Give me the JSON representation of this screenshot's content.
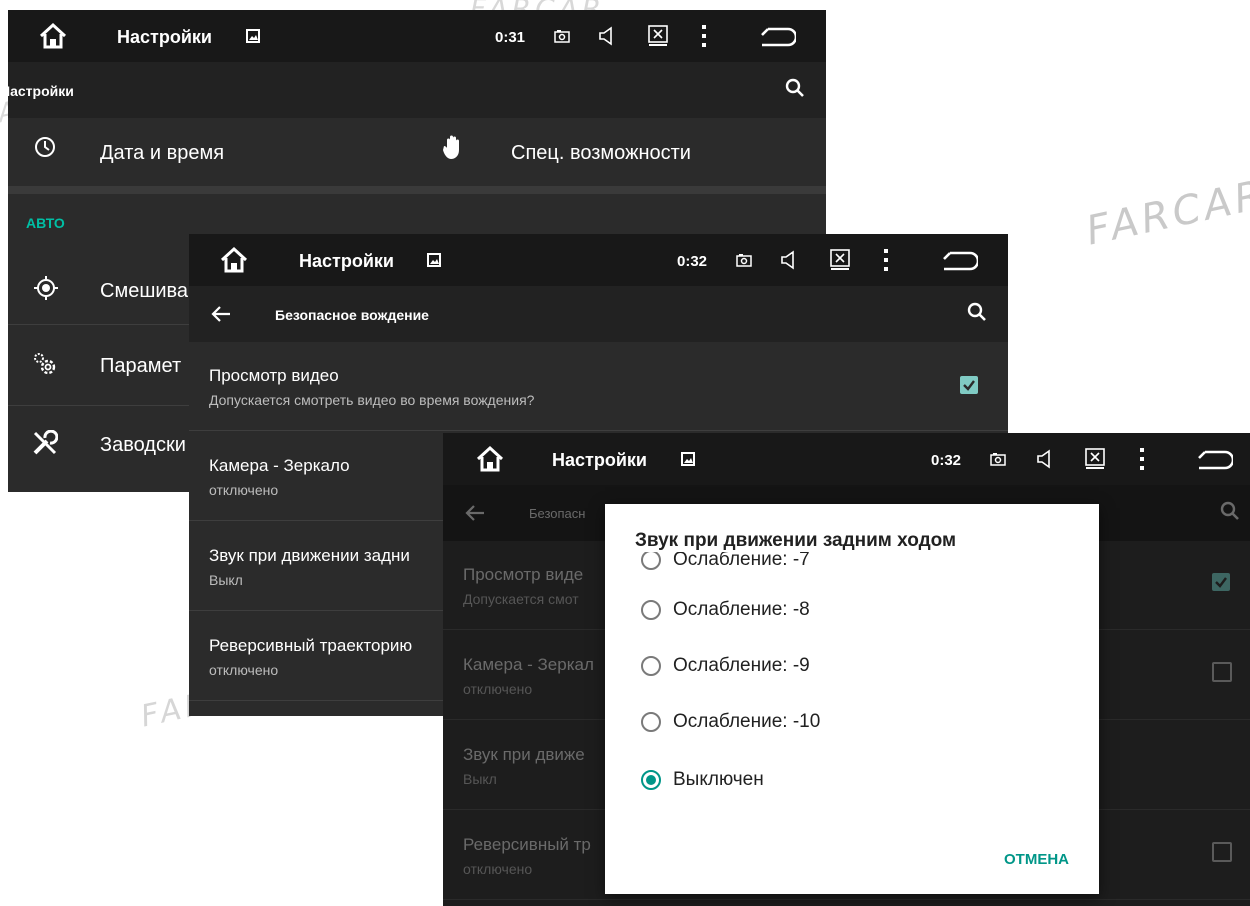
{
  "watermark": "FARCAR",
  "icons": {
    "home": "home-icon",
    "image": "image-icon",
    "camera": "camera-icon",
    "volume": "volume-icon",
    "close_box": "close-box-icon",
    "more": "more-vert-icon",
    "back": "back-icon",
    "search": "search-icon",
    "arrow_back": "arrow-back-icon"
  },
  "colors": {
    "accent": "#009688",
    "checkbox_on": "#80cbc4",
    "panel_bg": "#2b2b2b",
    "statusbar_bg": "#181818"
  },
  "screen1": {
    "status": {
      "title": "Настройки",
      "time": "0:31"
    },
    "toolbar": {
      "title": "Настройки"
    },
    "dashboard": [
      {
        "label": "Дата и время",
        "icon": "clock-icon"
      },
      {
        "label": "Спец. возможности",
        "icon": "hand-icon"
      }
    ],
    "section_header": "АВТО",
    "items": [
      {
        "label": "Смешива",
        "icon": "gps-icon"
      },
      {
        "label": "Парамет",
        "icon": "settings-gears-icon"
      },
      {
        "label": "Заводски",
        "icon": "tools-icon"
      }
    ]
  },
  "screen2": {
    "status": {
      "title": "Настройки",
      "time": "0:32"
    },
    "toolbar": {
      "title": "Безопасное вождение"
    },
    "prefs": [
      {
        "title": "Просмотр видео",
        "summary": "Допускается смотреть видео во время вождения?",
        "checkbox": true
      },
      {
        "title": "Камера - Зеркало",
        "summary": "отключено"
      },
      {
        "title": "Звук при движении задни",
        "summary": "Выкл"
      },
      {
        "title": "Реверсивный траекторию",
        "summary": "отключено"
      }
    ]
  },
  "screen3": {
    "status": {
      "title": "Настройки",
      "time": "0:32"
    },
    "toolbar": {
      "title": "Безопасн"
    },
    "prefs": [
      {
        "title": "Просмотр виде",
        "summary": "Допускается смот",
        "checkbox": true
      },
      {
        "title": "Камера - Зеркал",
        "summary": "отключено",
        "checkbox": false
      },
      {
        "title": "Звук при движе",
        "summary": "Выкл"
      },
      {
        "title": "Реверсивный тр",
        "summary": "отключено",
        "checkbox": false
      }
    ],
    "dialog": {
      "title": "Звук при движении задним ходом",
      "partial_option": "Ослабление: -7",
      "options": [
        "Ослабление: -8",
        "Ослабление: -9",
        "Ослабление: -10",
        "Выключен"
      ],
      "selected": "Выключен",
      "cancel_label": "ОТМЕНА"
    }
  }
}
